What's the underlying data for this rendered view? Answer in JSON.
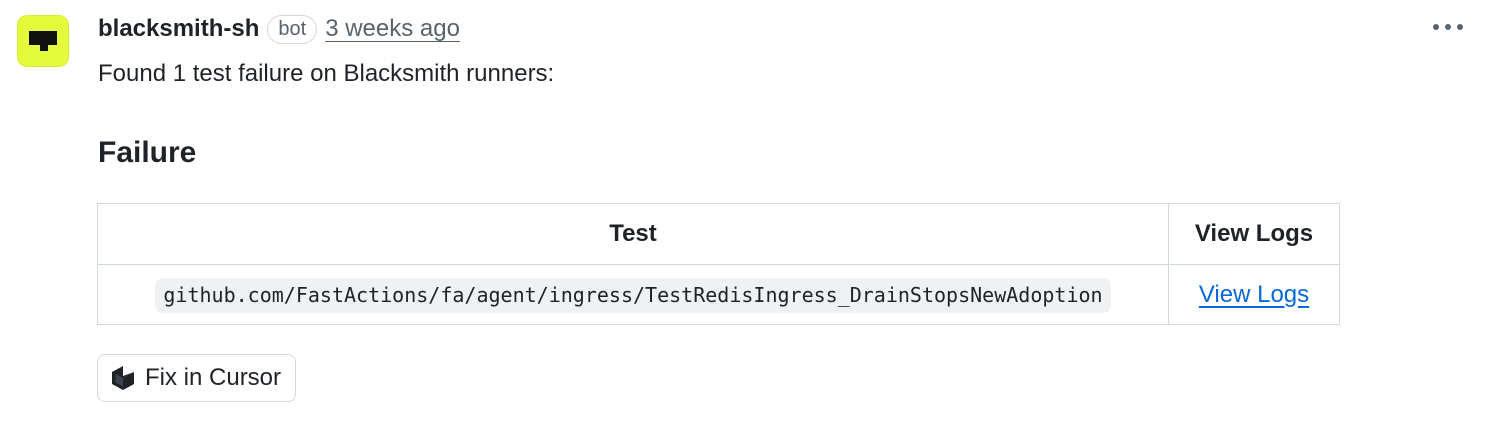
{
  "comment": {
    "author": "blacksmith-sh",
    "badge": "bot",
    "timestamp": "3 weeks ago",
    "avatar_color": "#e4fb3c",
    "intro": "Found 1 test failure on Blacksmith runners:",
    "section_heading": "Failure",
    "table": {
      "headers": [
        "Test",
        "View Logs"
      ],
      "rows": [
        {
          "test": "github.com/FastActions/fa/agent/ingress/TestRedisIngress_DrainStopsNewAdoption",
          "link": "View Logs"
        }
      ]
    },
    "fix_button": {
      "label": "Fix in Cursor",
      "icon": "cursor-cube-icon"
    },
    "menu_icon": "kebab-horizontal-icon"
  },
  "colors": {
    "link": "#0969da",
    "muted": "#59636e",
    "border": "#d1d9e0",
    "code_bg": "#eff1f3"
  }
}
